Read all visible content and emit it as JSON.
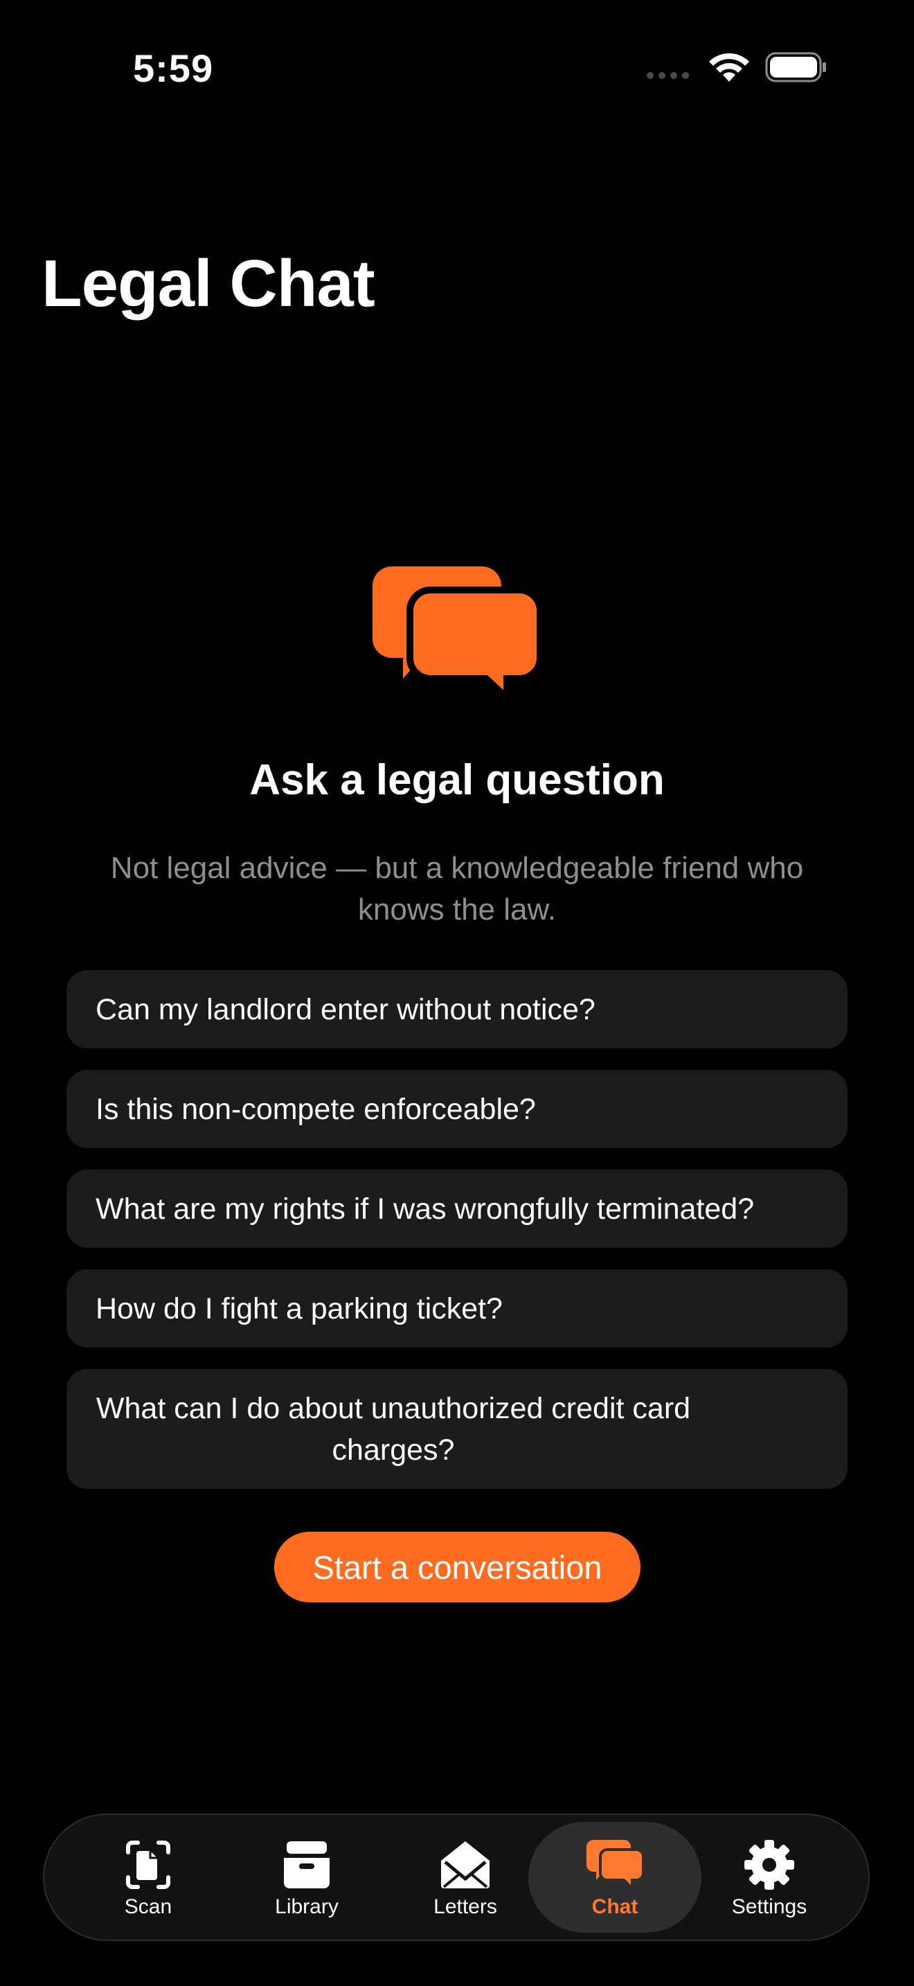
{
  "status_bar": {
    "time": "5:59",
    "icons": [
      "cellular-signal-icon",
      "wifi-icon",
      "battery-icon"
    ]
  },
  "header": {
    "title": "Legal Chat"
  },
  "empty_state": {
    "icon": "chat-bubbles-icon",
    "heading": "Ask a legal question",
    "subtitle": "Not legal advice — but a knowledgeable friend who knows the law."
  },
  "suggestions": [
    {
      "label": "Can my landlord enter without notice?"
    },
    {
      "label": "Is this non-compete enforceable?"
    },
    {
      "label": "What are my rights if I was wrongfully terminated?"
    },
    {
      "label": "How do I fight a parking ticket?"
    },
    {
      "label": "What can I do about unauthorized credit card charges?"
    }
  ],
  "cta": {
    "label": "Start a conversation"
  },
  "tab_bar": {
    "active": "Chat",
    "tabs": [
      {
        "label": "Scan",
        "icon": "scan-document-icon"
      },
      {
        "label": "Library",
        "icon": "tray-archive-icon"
      },
      {
        "label": "Letters",
        "icon": "open-envelope-icon"
      },
      {
        "label": "Chat",
        "icon": "chat-bubbles-icon"
      },
      {
        "label": "Settings",
        "icon": "gear-icon"
      }
    ]
  },
  "colors": {
    "accent": "#ff6b1f",
    "background": "#000000",
    "card": "#1c1c1e",
    "secondary_text": "#8e8e93"
  }
}
